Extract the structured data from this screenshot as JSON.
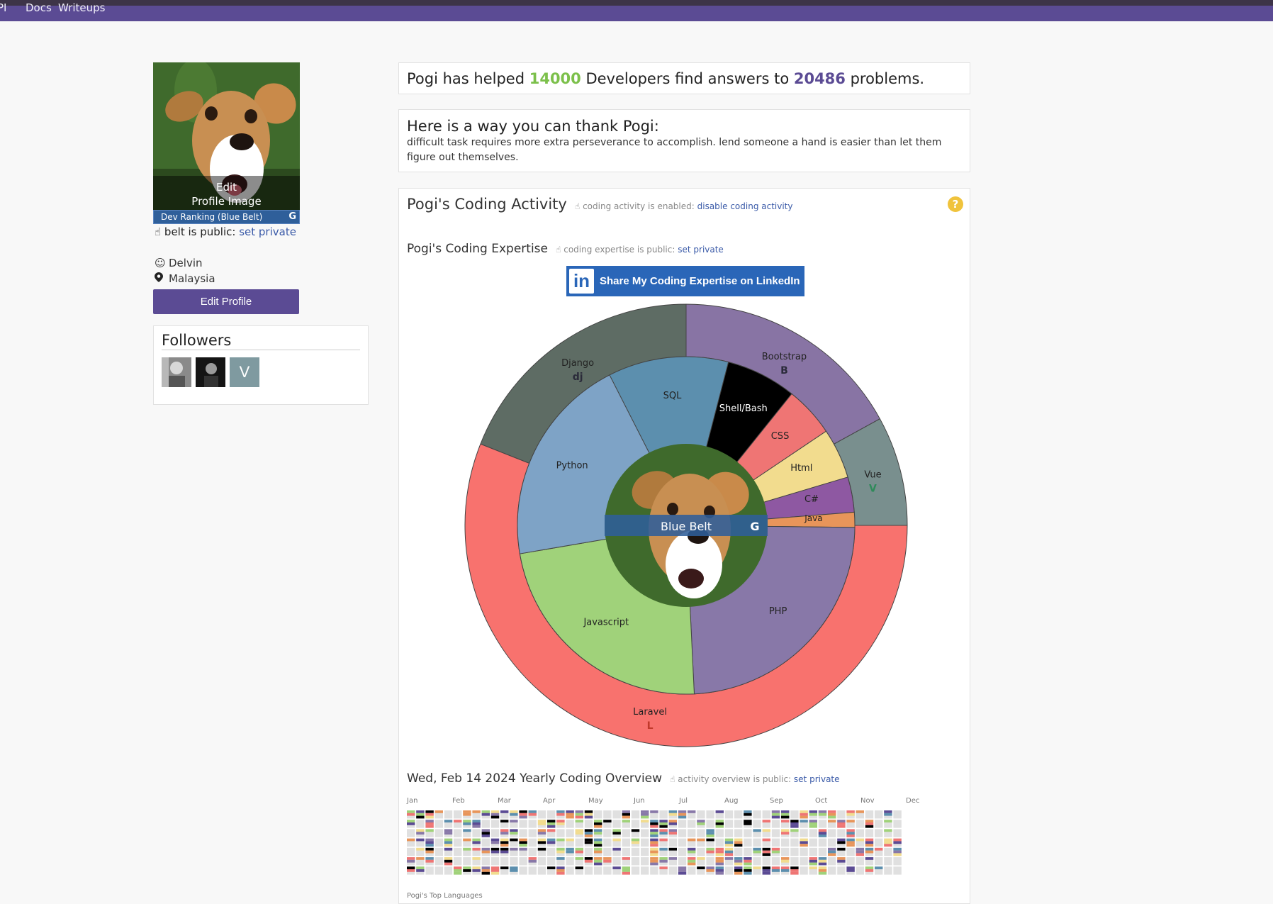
{
  "nav": {
    "items": [
      "PI",
      "Docs",
      "Writeups"
    ]
  },
  "profile": {
    "edit_image_label": "Edit",
    "edit_image_label2": "Profile Image",
    "rank_label": "Dev Ranking (Blue Belt)",
    "rank_badge": "G",
    "belt_public_text": "belt is public:",
    "belt_link": "set private",
    "name": "Delvin",
    "location": "Malaysia",
    "edit_profile_button": "Edit Profile"
  },
  "followers": {
    "title": "Followers",
    "items": [
      {
        "type": "photo",
        "label": ""
      },
      {
        "type": "photo",
        "label": ""
      },
      {
        "type": "letter",
        "label": "V"
      }
    ]
  },
  "helped": {
    "prefix": "Pogi has helped ",
    "developers": "14000",
    "middle": " Developers find answers to ",
    "problems": "20486",
    "suffix": " problems."
  },
  "thank": {
    "title": "Here is a way you can thank Pogi:",
    "message": "difficult task requires more extra perseverance to accomplish. lend someone a hand is easier than let them figure out themselves."
  },
  "activity": {
    "title": "Pogi's Coding Activity",
    "status_text": "coding activity is enabled:",
    "status_link": "disable coding activity",
    "help": "?"
  },
  "expertise": {
    "title": "Pogi's Coding Expertise",
    "status_text": "coding expertise is public:",
    "status_link": "set private",
    "linkedin_label": "Share My Coding Expertise on LinkedIn",
    "linkedin_logo": "in"
  },
  "chart_data": {
    "type": "pie",
    "center_label": "Blue Belt",
    "center_badge": "G",
    "inner": [
      {
        "name": "SQL",
        "value": 12,
        "color": "#5c8fae"
      },
      {
        "name": "Shell/Bash",
        "value": 7,
        "color": "#000000"
      },
      {
        "name": "CSS",
        "value": 5,
        "color": "#ef7574"
      },
      {
        "name": "Html",
        "value": 5,
        "color": "#f2dc8e"
      },
      {
        "name": "C#",
        "value": 3.5,
        "color": "#8e58a2"
      },
      {
        "name": "Java",
        "value": 1.5,
        "color": "#e8955a"
      },
      {
        "name": "PHP",
        "value": 25,
        "color": "#8878a8"
      },
      {
        "name": "Javascript",
        "value": 24,
        "color": "#a0d27a"
      },
      {
        "name": "Python",
        "value": 21,
        "color": "#7ea3c6"
      }
    ],
    "outer": [
      {
        "name": "Bootstrap",
        "value": 17,
        "color": "#8874a4",
        "icon": "B"
      },
      {
        "name": "Vue",
        "value": 8,
        "color": "#798f8e",
        "icon": "V"
      },
      {
        "name": "Laravel",
        "value": 56,
        "color": "#f8726e",
        "icon": "L"
      },
      {
        "name": "Django",
        "value": 19,
        "color": "#5e6c64",
        "icon": "dj"
      }
    ]
  },
  "overview": {
    "title": "Wed, Feb 14 2024 Yearly Coding Overview",
    "status_text": "activity overview is public:",
    "status_link": "set private",
    "months": [
      "Jan",
      "Feb",
      "Mar",
      "Apr",
      "May",
      "Jun",
      "Jul",
      "Aug",
      "Sep",
      "Oct",
      "Nov",
      "Dec"
    ],
    "palette": [
      "#e0e0e0",
      "#a0d27a",
      "#ef7574",
      "#5c8fae",
      "#000000",
      "#f2dc8e",
      "#8878a8",
      "#e8955a",
      "#5b4b94"
    ],
    "top_languages_label": "Pogi's Top Languages"
  }
}
